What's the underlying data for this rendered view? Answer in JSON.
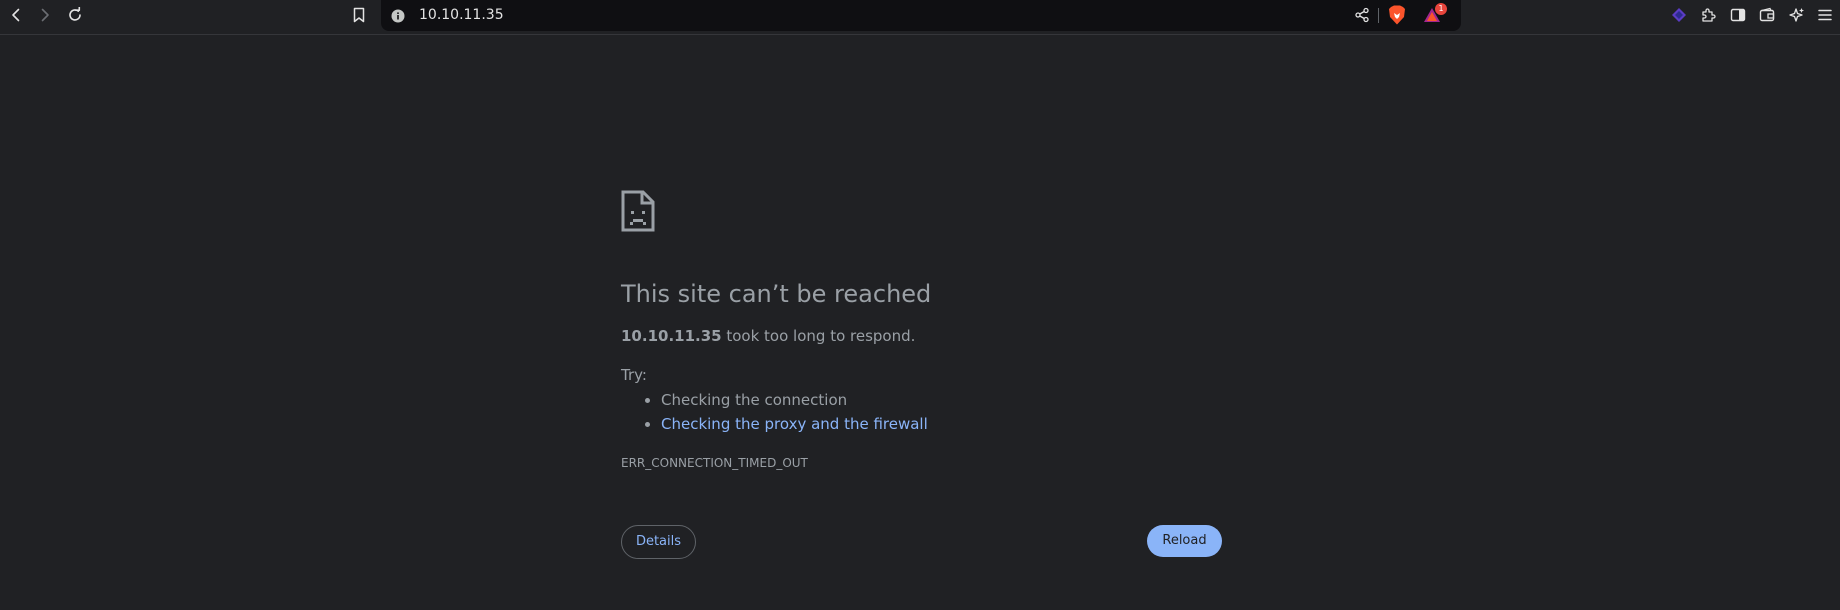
{
  "browser": {
    "url": "10.10.11.35",
    "notification_count": "1",
    "icons": {
      "back": "back-arrow-icon",
      "forward": "forward-arrow-icon",
      "reload": "reload-icon",
      "bookmark": "bookmark-icon",
      "site_info": "info-icon",
      "share": "share-icon",
      "brave_shields": "brave-lion-icon",
      "brave_rewards": "rewards-triangle-icon",
      "extension_logo": "purple-diamond-icon",
      "extensions": "puzzle-piece-icon",
      "sidebar": "sidebar-icon",
      "wallet": "wallet-icon",
      "leo": "sparkle-icon",
      "menu": "hamburger-menu-icon"
    },
    "colors": {
      "background": "#202124",
      "urlbar_bg": "#0f0f12",
      "link": "#8ab4f8",
      "text": "#9aa0a6",
      "brave_orange": "#fb542b",
      "badge_red": "#e8453c"
    }
  },
  "error_page": {
    "title": "This site can’t be reached",
    "host": "10.10.11.35",
    "summary_rest": " took too long to respond.",
    "try_label": "Try:",
    "suggestions": [
      "Checking the connection",
      "Checking the proxy and the firewall"
    ],
    "error_code": "ERR_CONNECTION_TIMED_OUT",
    "details_label": "Details",
    "reload_label": "Reload"
  }
}
